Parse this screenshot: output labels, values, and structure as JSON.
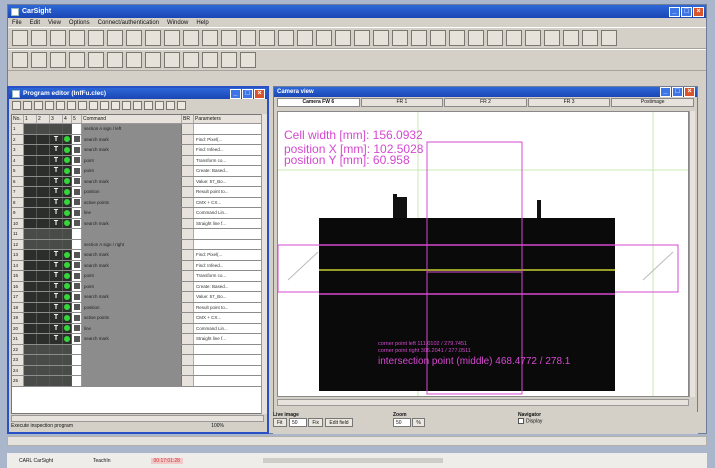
{
  "app": {
    "title": "CarSight"
  },
  "menu": [
    "File",
    "Edit",
    "View",
    "Options",
    "Connect/authentication",
    "Window",
    "Help"
  ],
  "toolbar_row1": [
    "camera-icon",
    "gear-icon",
    "cross-icon",
    "pencil-icon",
    "grid-icon",
    "image-icon",
    "record-icon",
    "monitor-icon",
    "save-icon",
    "tool-icon",
    "layers-icon",
    "ruler-icon",
    "paint-icon",
    "measure-icon",
    "magic-icon",
    "tag-icon",
    "plug-icon",
    "flag-icon",
    "arrow-icon",
    "settings-icon",
    "stop-icon",
    "play-icon",
    "window-icon",
    "cascade-icon",
    "line-icon",
    "export-icon",
    "print-icon",
    "dark-icon",
    "delete-icon",
    "draw-icon",
    "help-icon",
    "check-icon"
  ],
  "toolbar_row2": [
    "select-icon",
    "table-icon",
    "folder-icon",
    "copy-icon",
    "panel-icon",
    "zoom-icon",
    "chart-icon",
    "cube-icon",
    "film-icon",
    "pen-icon",
    "bar-icon",
    "doc-icon",
    "window-small-icon"
  ],
  "program_editor": {
    "title": "Program editor (InfFu.clec)",
    "columns": [
      "No.",
      "1",
      "2",
      "3",
      "4",
      "5",
      "Command",
      "BR",
      "Parameters"
    ],
    "rows": [
      {
        "no": "1",
        "tag": "",
        "cmd": "section A sign / left",
        "p": ""
      },
      {
        "no": "2",
        "tag": "T",
        "cmd": "search mark",
        "p": "Find: Pixel(..."
      },
      {
        "no": "3",
        "tag": "T",
        "cmd": "search mark",
        "p": "Find: Infeed..."
      },
      {
        "no": "4",
        "tag": "T",
        "cmd": "point",
        "p": "Transform co..."
      },
      {
        "no": "5",
        "tag": "T",
        "cmd": "point",
        "p": "Create: Based..."
      },
      {
        "no": "6",
        "tag": "T",
        "cmd": "search mark",
        "p": "Value: 57_Bo..."
      },
      {
        "no": "7",
        "tag": "T",
        "cmd": "position",
        "p": "Result point to..."
      },
      {
        "no": "8",
        "tag": "T",
        "cmd": "active points",
        "p": "CMX + CX..."
      },
      {
        "no": "9",
        "tag": "T",
        "cmd": "line",
        "p": "Command Lin..."
      },
      {
        "no": "10",
        "tag": "T",
        "cmd": "search mark",
        "p": "Straight line f..."
      },
      {
        "no": "11",
        "tag": "",
        "cmd": "",
        "p": ""
      },
      {
        "no": "12",
        "tag": "",
        "cmd": "section A sign / right",
        "p": ""
      },
      {
        "no": "13",
        "tag": "T",
        "cmd": "search mark",
        "p": "Find: Pixel(..."
      },
      {
        "no": "14",
        "tag": "T",
        "cmd": "search mark",
        "p": "Find: Infeed..."
      },
      {
        "no": "15",
        "tag": "T",
        "cmd": "point",
        "p": "Transform co..."
      },
      {
        "no": "16",
        "tag": "T",
        "cmd": "point",
        "p": "Create: Based..."
      },
      {
        "no": "17",
        "tag": "T",
        "cmd": "search mark",
        "p": "Value: 57_Bo..."
      },
      {
        "no": "18",
        "tag": "T",
        "cmd": "position",
        "p": "Result point to..."
      },
      {
        "no": "19",
        "tag": "T",
        "cmd": "active points",
        "p": "CMX + CX..."
      },
      {
        "no": "20",
        "tag": "T",
        "cmd": "line",
        "p": "Command Lin..."
      },
      {
        "no": "21",
        "tag": "T",
        "cmd": "search mark",
        "p": "Straight line f..."
      },
      {
        "no": "22",
        "tag": "",
        "cmd": "",
        "p": ""
      },
      {
        "no": "23",
        "tag": "",
        "cmd": "",
        "p": ""
      },
      {
        "no": "24",
        "tag": "",
        "cmd": "",
        "p": ""
      },
      {
        "no": "25",
        "tag": "",
        "cmd": "",
        "p": ""
      }
    ],
    "status": "Execute inspection program",
    "zoom": "100%"
  },
  "camera": {
    "title": "Camera view",
    "tabs": [
      "Camera FW 6",
      "FR 1",
      "FR 2",
      "FR 3",
      "Postimage"
    ],
    "cell_width": "Cell width [mm]: 156.0932",
    "pos_x": "position X [mm]: 102.5028",
    "pos_y": "position Y [mm]: 60.958",
    "corner_left": "corner point left 111.0102 / 279.7451",
    "corner_right": "corner point right 306.2041 / 277.0511",
    "intersection": "intersection point (middle) 468.4772 / 278.1",
    "accent": "#d548d0"
  },
  "controls": {
    "image": {
      "label": "Live image",
      "btn1": "Fit",
      "value": "50",
      "btn2": "Fix",
      "btn3": "Edit field"
    },
    "zoom": {
      "label": "Zoom",
      "value": "50",
      "unit": "%"
    },
    "navigator": {
      "label": "Navigator",
      "check": "Display"
    }
  },
  "taskbar": {
    "item1": "CARL CarSight",
    "item2": "TeachIn",
    "item3": "00:17:01:28"
  }
}
